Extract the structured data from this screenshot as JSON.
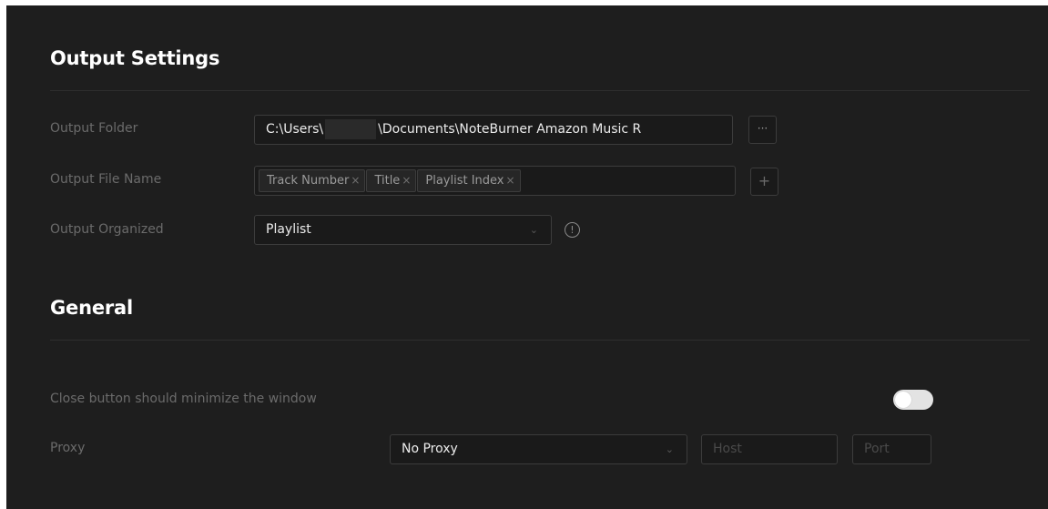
{
  "output_settings": {
    "title": "Output Settings",
    "output_folder": {
      "label": "Output Folder",
      "value_prefix": "C:\\Users\\",
      "value_suffix": "\\Documents\\NoteBurner Amazon Music R",
      "browse_label": "···"
    },
    "output_file_name": {
      "label": "Output File Name",
      "tags": [
        "Track Number",
        "Title",
        "Playlist Index"
      ],
      "remove_symbol": "×",
      "add_label": "+"
    },
    "output_organized": {
      "label": "Output Organized",
      "selected": "Playlist",
      "info_symbol": "!"
    }
  },
  "general": {
    "title": "General",
    "close_minimize": {
      "label": "Close button should minimize the window",
      "enabled": false
    },
    "proxy": {
      "label": "Proxy",
      "selected": "No Proxy",
      "host_placeholder": "Host",
      "port_placeholder": "Port"
    }
  },
  "icons": {
    "chevron": "chevron-down-icon",
    "info": "info-icon",
    "browse": "more-icon",
    "add": "plus-icon"
  },
  "colors": {
    "background": "#1e1e1e",
    "heading": "#ffffff",
    "label": "#6b6b6b",
    "border": "#3c3c3c",
    "toggle": "#e3e3e3"
  }
}
